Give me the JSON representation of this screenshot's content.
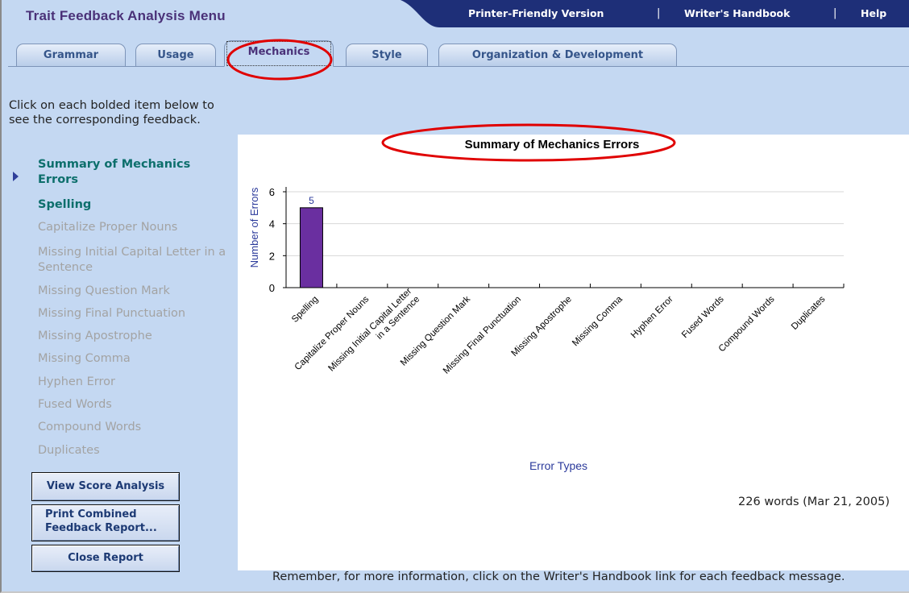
{
  "header": {
    "title": "Trait Feedback Analysis Menu",
    "nav_links": [
      "Printer-Friendly Version",
      "Writer's Handbook",
      "Help"
    ],
    "nav_separator": "|",
    "nav_bar_color": "#1e2f78"
  },
  "tabs": [
    {
      "label": "Grammar",
      "active": false
    },
    {
      "label": "Usage",
      "active": false
    },
    {
      "label": "Mechanics",
      "active": true
    },
    {
      "label": "Style",
      "active": false
    },
    {
      "label": "Organization & Development",
      "active": false
    }
  ],
  "sidebar": {
    "instructions": "Click on each bolded item below to see the corresponding feedback.",
    "items": [
      {
        "label": "Summary of Mechanics Errors",
        "bold": true,
        "selected": true
      },
      {
        "label": "Spelling",
        "bold": true,
        "selected": false
      },
      {
        "label": "Capitalize Proper Nouns",
        "bold": false
      },
      {
        "label": "Missing Initial Capital Letter in a Sentence",
        "bold": false
      },
      {
        "label": "Missing Question Mark",
        "bold": false
      },
      {
        "label": "Missing Final Punctuation",
        "bold": false
      },
      {
        "label": "Missing Apostrophe",
        "bold": false
      },
      {
        "label": "Missing Comma",
        "bold": false
      },
      {
        "label": "Hyphen Error",
        "bold": false
      },
      {
        "label": "Fused Words",
        "bold": false
      },
      {
        "label": "Compound Words",
        "bold": false
      },
      {
        "label": "Duplicates",
        "bold": false
      }
    ],
    "buttons": {
      "view_score": "View Score Analysis",
      "print_combined": "Print Combined Feedback Report...",
      "close_report": "Close Report"
    }
  },
  "chart_data": {
    "type": "bar",
    "title": "Summary of Mechanics Errors",
    "xlabel": "Error Types",
    "ylabel": "Number of Errors",
    "categories": [
      "Spelling",
      "Capitalize Proper Nouns",
      "Missing Initial Capital Letter in a Sentence",
      "Missing Question Mark",
      "Missing Final Punctuation",
      "Missing Apostrophe",
      "Missing Comma",
      "Hyphen Error",
      "Fused Words",
      "Compound Words",
      "Duplicates"
    ],
    "values": [
      5,
      0,
      0,
      0,
      0,
      0,
      0,
      0,
      0,
      0,
      0
    ],
    "data_labels": [
      "5",
      "",
      "",
      "",
      "",
      "",
      "",
      "",
      "",
      "",
      ""
    ],
    "yticks": [
      "0",
      "2",
      "4",
      "6"
    ],
    "ylim": [
      0,
      6
    ],
    "grid": true,
    "bar_color": "#6a2fa0",
    "label_color": "#2b3a9b"
  },
  "footer": {
    "word_count": "226 words (Mar 21, 2005)",
    "note": "Remember, for more information, click on the Writer's Handbook link for each feedback message."
  },
  "annotation_color": "#e00000"
}
